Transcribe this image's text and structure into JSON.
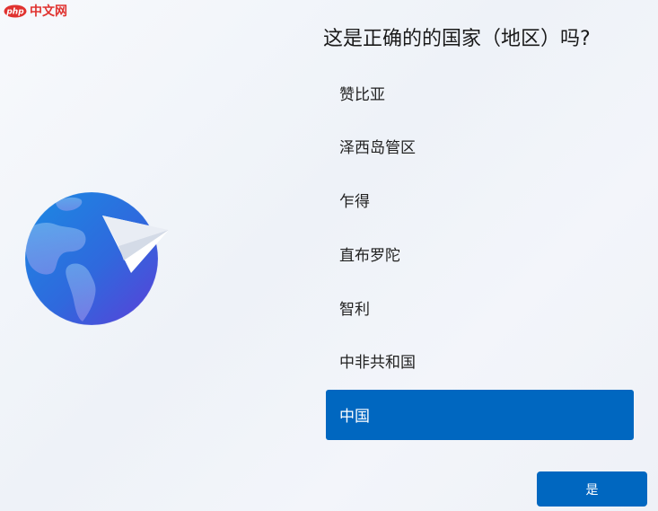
{
  "watermark": {
    "logo_text": "php",
    "site_text": "中文网"
  },
  "title": "这是正确的的国家（地区）吗?",
  "countries": [
    {
      "label": "赞比亚",
      "selected": false
    },
    {
      "label": "泽西岛管区",
      "selected": false
    },
    {
      "label": "乍得",
      "selected": false
    },
    {
      "label": "直布罗陀",
      "selected": false
    },
    {
      "label": "智利",
      "selected": false
    },
    {
      "label": "中非共和国",
      "selected": false
    },
    {
      "label": "中国",
      "selected": true
    }
  ],
  "buttons": {
    "yes_label": "是"
  },
  "colors": {
    "accent": "#0067c0",
    "watermark": "#e0322f"
  },
  "icons": {
    "illustration": "globe-paper-plane-icon",
    "watermark_logo": "php-logo-icon"
  }
}
